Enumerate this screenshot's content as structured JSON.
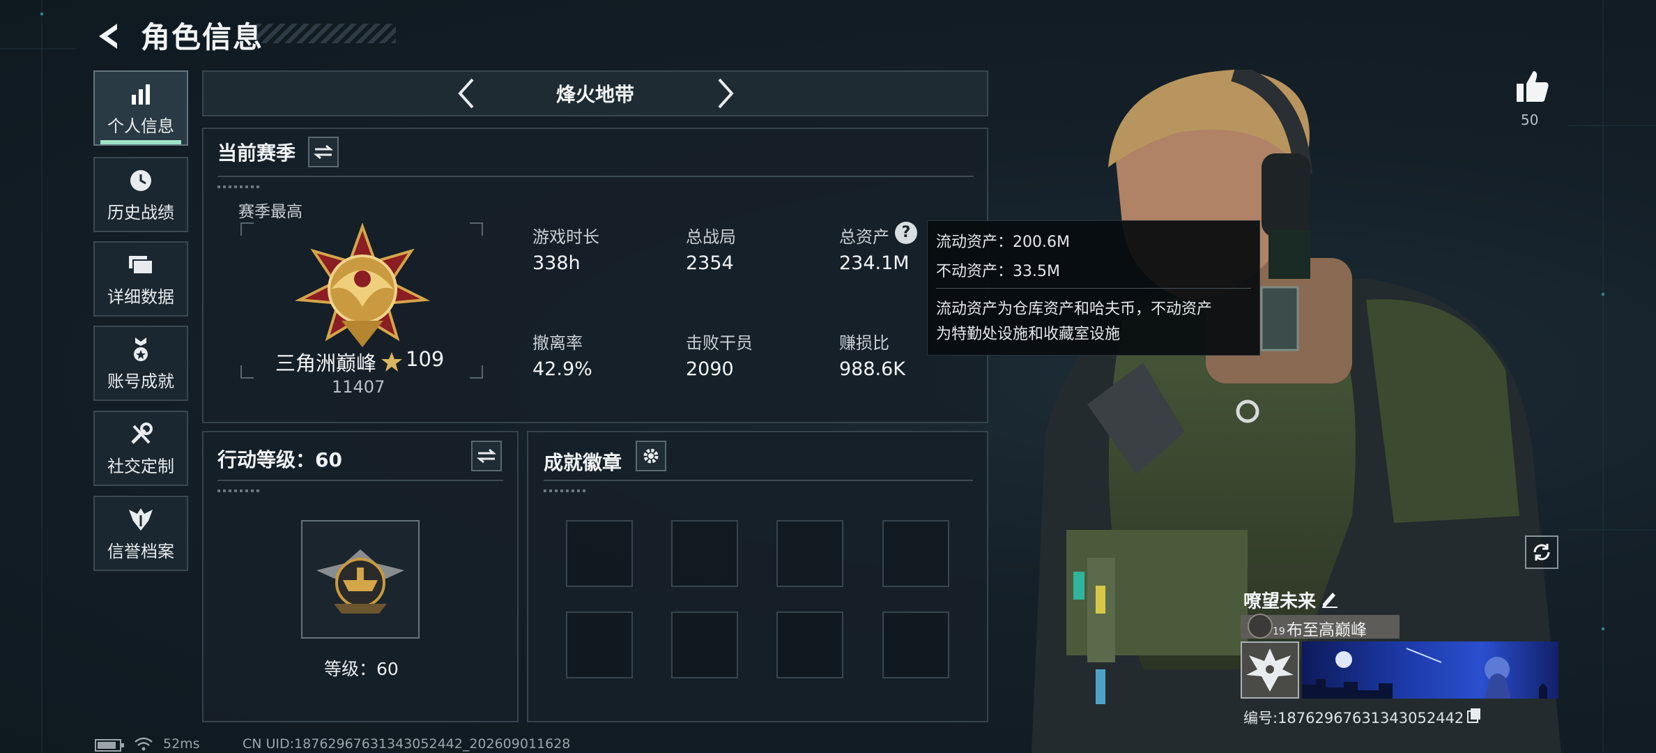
{
  "header": {
    "title": "角色信息"
  },
  "sidebar": {
    "items": [
      {
        "label": "个人信息",
        "icon": "bar-chart-icon",
        "active": true
      },
      {
        "label": "历史战绩",
        "icon": "clock-icon",
        "active": false
      },
      {
        "label": "详细数据",
        "icon": "stacked-cards-icon",
        "active": false
      },
      {
        "label": "账号成就",
        "icon": "achievement-icon",
        "active": false
      },
      {
        "label": "社交定制",
        "icon": "tools-icon",
        "active": false
      },
      {
        "label": "信誉档案",
        "icon": "shield-wings-icon",
        "active": false
      }
    ]
  },
  "mode": {
    "name": "烽火地带"
  },
  "season": {
    "title": "当前赛季",
    "best_label": "赛季最高",
    "rank_name": "三角洲巅峰",
    "rank_stars": "109",
    "rank_score": "11407",
    "stats": [
      {
        "label": "游戏时长",
        "value": "338h"
      },
      {
        "label": "总战局",
        "value": "2354"
      },
      {
        "label": "总资产",
        "value": "234.1M"
      },
      {
        "label": "撤离率",
        "value": "42.9%"
      },
      {
        "label": "击败干员",
        "value": "2090"
      },
      {
        "label": "赚损比",
        "value": "988.6K"
      }
    ]
  },
  "tooltip": {
    "liquid": "流动资产：200.6M",
    "fixed": "不动资产：33.5M",
    "desc1": "流动资产为仓库资产和哈夫币，不动资产",
    "desc2": "为特勤处设施和收藏室设施"
  },
  "action_level": {
    "title": "行动等级：60",
    "level_text": "等级：60"
  },
  "achievements": {
    "title": "成就徽章",
    "slots": 8
  },
  "likes": {
    "count": "50"
  },
  "player_card": {
    "name": "嘹望未来",
    "badge_level": "19",
    "tag": "布至高巅峰",
    "id_text": "编号:18762967631343052442"
  },
  "status_bar": {
    "ping": "52ms",
    "uid": "CN UID:18762967631343052442_202609011628"
  },
  "colors": {
    "accent": "#9ee3c9",
    "gold": "#d4a64a"
  }
}
